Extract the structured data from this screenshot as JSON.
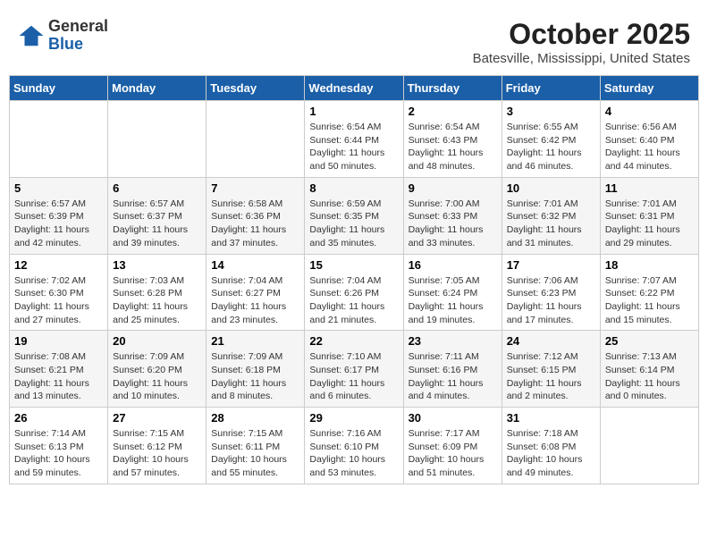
{
  "logo": {
    "general": "General",
    "blue": "Blue"
  },
  "title": {
    "month": "October 2025",
    "location": "Batesville, Mississippi, United States"
  },
  "days_of_week": [
    "Sunday",
    "Monday",
    "Tuesday",
    "Wednesday",
    "Thursday",
    "Friday",
    "Saturday"
  ],
  "weeks": [
    [
      {
        "day": "",
        "info": ""
      },
      {
        "day": "",
        "info": ""
      },
      {
        "day": "",
        "info": ""
      },
      {
        "day": "1",
        "info": "Sunrise: 6:54 AM\nSunset: 6:44 PM\nDaylight: 11 hours\nand 50 minutes."
      },
      {
        "day": "2",
        "info": "Sunrise: 6:54 AM\nSunset: 6:43 PM\nDaylight: 11 hours\nand 48 minutes."
      },
      {
        "day": "3",
        "info": "Sunrise: 6:55 AM\nSunset: 6:42 PM\nDaylight: 11 hours\nand 46 minutes."
      },
      {
        "day": "4",
        "info": "Sunrise: 6:56 AM\nSunset: 6:40 PM\nDaylight: 11 hours\nand 44 minutes."
      }
    ],
    [
      {
        "day": "5",
        "info": "Sunrise: 6:57 AM\nSunset: 6:39 PM\nDaylight: 11 hours\nand 42 minutes."
      },
      {
        "day": "6",
        "info": "Sunrise: 6:57 AM\nSunset: 6:37 PM\nDaylight: 11 hours\nand 39 minutes."
      },
      {
        "day": "7",
        "info": "Sunrise: 6:58 AM\nSunset: 6:36 PM\nDaylight: 11 hours\nand 37 minutes."
      },
      {
        "day": "8",
        "info": "Sunrise: 6:59 AM\nSunset: 6:35 PM\nDaylight: 11 hours\nand 35 minutes."
      },
      {
        "day": "9",
        "info": "Sunrise: 7:00 AM\nSunset: 6:33 PM\nDaylight: 11 hours\nand 33 minutes."
      },
      {
        "day": "10",
        "info": "Sunrise: 7:01 AM\nSunset: 6:32 PM\nDaylight: 11 hours\nand 31 minutes."
      },
      {
        "day": "11",
        "info": "Sunrise: 7:01 AM\nSunset: 6:31 PM\nDaylight: 11 hours\nand 29 minutes."
      }
    ],
    [
      {
        "day": "12",
        "info": "Sunrise: 7:02 AM\nSunset: 6:30 PM\nDaylight: 11 hours\nand 27 minutes."
      },
      {
        "day": "13",
        "info": "Sunrise: 7:03 AM\nSunset: 6:28 PM\nDaylight: 11 hours\nand 25 minutes."
      },
      {
        "day": "14",
        "info": "Sunrise: 7:04 AM\nSunset: 6:27 PM\nDaylight: 11 hours\nand 23 minutes."
      },
      {
        "day": "15",
        "info": "Sunrise: 7:04 AM\nSunset: 6:26 PM\nDaylight: 11 hours\nand 21 minutes."
      },
      {
        "day": "16",
        "info": "Sunrise: 7:05 AM\nSunset: 6:24 PM\nDaylight: 11 hours\nand 19 minutes."
      },
      {
        "day": "17",
        "info": "Sunrise: 7:06 AM\nSunset: 6:23 PM\nDaylight: 11 hours\nand 17 minutes."
      },
      {
        "day": "18",
        "info": "Sunrise: 7:07 AM\nSunset: 6:22 PM\nDaylight: 11 hours\nand 15 minutes."
      }
    ],
    [
      {
        "day": "19",
        "info": "Sunrise: 7:08 AM\nSunset: 6:21 PM\nDaylight: 11 hours\nand 13 minutes."
      },
      {
        "day": "20",
        "info": "Sunrise: 7:09 AM\nSunset: 6:20 PM\nDaylight: 11 hours\nand 10 minutes."
      },
      {
        "day": "21",
        "info": "Sunrise: 7:09 AM\nSunset: 6:18 PM\nDaylight: 11 hours\nand 8 minutes."
      },
      {
        "day": "22",
        "info": "Sunrise: 7:10 AM\nSunset: 6:17 PM\nDaylight: 11 hours\nand 6 minutes."
      },
      {
        "day": "23",
        "info": "Sunrise: 7:11 AM\nSunset: 6:16 PM\nDaylight: 11 hours\nand 4 minutes."
      },
      {
        "day": "24",
        "info": "Sunrise: 7:12 AM\nSunset: 6:15 PM\nDaylight: 11 hours\nand 2 minutes."
      },
      {
        "day": "25",
        "info": "Sunrise: 7:13 AM\nSunset: 6:14 PM\nDaylight: 11 hours\nand 0 minutes."
      }
    ],
    [
      {
        "day": "26",
        "info": "Sunrise: 7:14 AM\nSunset: 6:13 PM\nDaylight: 10 hours\nand 59 minutes."
      },
      {
        "day": "27",
        "info": "Sunrise: 7:15 AM\nSunset: 6:12 PM\nDaylight: 10 hours\nand 57 minutes."
      },
      {
        "day": "28",
        "info": "Sunrise: 7:15 AM\nSunset: 6:11 PM\nDaylight: 10 hours\nand 55 minutes."
      },
      {
        "day": "29",
        "info": "Sunrise: 7:16 AM\nSunset: 6:10 PM\nDaylight: 10 hours\nand 53 minutes."
      },
      {
        "day": "30",
        "info": "Sunrise: 7:17 AM\nSunset: 6:09 PM\nDaylight: 10 hours\nand 51 minutes."
      },
      {
        "day": "31",
        "info": "Sunrise: 7:18 AM\nSunset: 6:08 PM\nDaylight: 10 hours\nand 49 minutes."
      },
      {
        "day": "",
        "info": ""
      }
    ]
  ]
}
